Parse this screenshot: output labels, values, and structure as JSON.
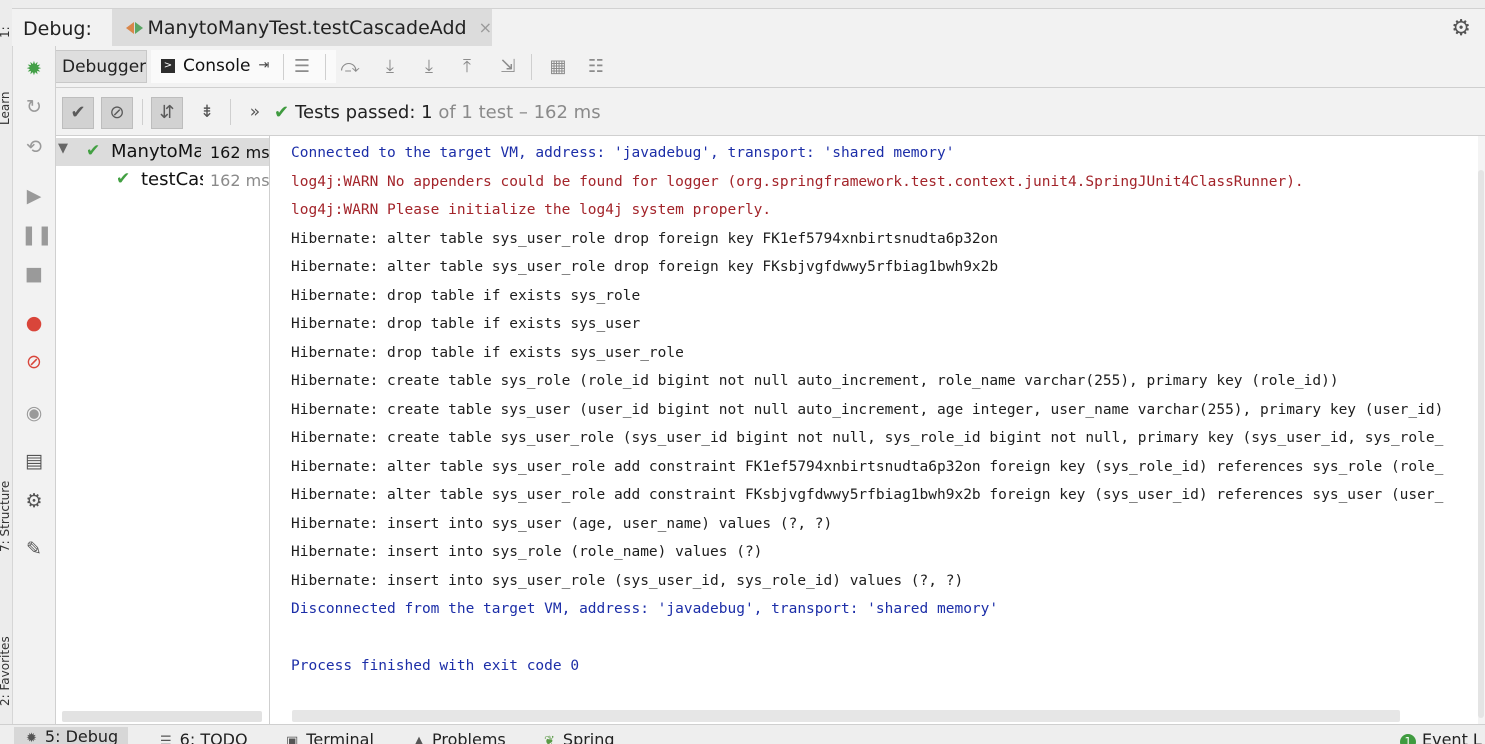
{
  "left_strip": {
    "labels": [
      "1:",
      "Learn",
      "7: Structure",
      "2: Favorites"
    ]
  },
  "debug_bar": {
    "label": "Debug:",
    "session_title": "ManytoManyTest.testCascadeAdd",
    "close_glyph": "×"
  },
  "tabs": {
    "debugger": "Debugger",
    "console": "Console"
  },
  "test_toolbar": {
    "status_prefix": "Tests passed:",
    "passed_count": "1",
    "status_suffix": "of 1 test – 162 ms"
  },
  "test_tree": [
    {
      "name": "ManytoMa",
      "time": "162 ms",
      "selected": true,
      "expanded": true
    },
    {
      "name": "testCas",
      "time": "162 ms",
      "selected": false
    }
  ],
  "console_lines": [
    {
      "text": "Connected to the target VM, address: 'javadebug', transport: 'shared memory'",
      "kind": "system"
    },
    {
      "text": "log4j:WARN No appenders could be found for logger (org.springframework.test.context.junit4.SpringJUnit4ClassRunner).",
      "kind": "error"
    },
    {
      "text": "log4j:WARN Please initialize the log4j system properly.",
      "kind": "error"
    },
    {
      "text": "Hibernate: alter table sys_user_role drop foreign key FK1ef5794xnbirtsnudta6p32on",
      "kind": "output"
    },
    {
      "text": "Hibernate: alter table sys_user_role drop foreign key FKsbjvgfdwwy5rfbiag1bwh9x2b",
      "kind": "output"
    },
    {
      "text": "Hibernate: drop table if exists sys_role",
      "kind": "output"
    },
    {
      "text": "Hibernate: drop table if exists sys_user",
      "kind": "output"
    },
    {
      "text": "Hibernate: drop table if exists sys_user_role",
      "kind": "output"
    },
    {
      "text": "Hibernate: create table sys_role (role_id bigint not null auto_increment, role_name varchar(255), primary key (role_id))",
      "kind": "output"
    },
    {
      "text": "Hibernate: create table sys_user (user_id bigint not null auto_increment, age integer, user_name varchar(255), primary key (user_id)",
      "kind": "output"
    },
    {
      "text": "Hibernate: create table sys_user_role (sys_user_id bigint not null, sys_role_id bigint not null, primary key (sys_user_id, sys_role_",
      "kind": "output"
    },
    {
      "text": "Hibernate: alter table sys_user_role add constraint FK1ef5794xnbirtsnudta6p32on foreign key (sys_role_id) references sys_role (role_",
      "kind": "output"
    },
    {
      "text": "Hibernate: alter table sys_user_role add constraint FKsbjvgfdwwy5rfbiag1bwh9x2b foreign key (sys_user_id) references sys_user (user_",
      "kind": "output"
    },
    {
      "text": "Hibernate: insert into sys_user (age, user_name) values (?, ?)",
      "kind": "output"
    },
    {
      "text": "Hibernate: insert into sys_role (role_name) values (?)",
      "kind": "output"
    },
    {
      "text": "Hibernate: insert into sys_user_role (sys_user_id, sys_role_id) values (?, ?)",
      "kind": "output"
    },
    {
      "text": "Disconnected from the target VM, address: 'javadebug', transport: 'shared memory'",
      "kind": "system"
    },
    {
      "text": "",
      "kind": "output"
    },
    {
      "text": "Process finished with exit code 0",
      "kind": "system"
    }
  ],
  "bottom_tabs": [
    {
      "label": "5: Debug",
      "icon": "bug-icon",
      "active": true
    },
    {
      "label": "6: TODO",
      "icon": "list-icon",
      "active": false
    },
    {
      "label": "Terminal",
      "icon": "terminal-icon",
      "active": false
    },
    {
      "label": "Problems",
      "icon": "warning-icon",
      "active": false
    },
    {
      "label": "Spring",
      "icon": "spring-leaf-icon",
      "active": false
    },
    {
      "label": "Event L",
      "icon": "event-log-icon",
      "active": false,
      "badge": "1"
    }
  ],
  "colors": {
    "system_text": "#1c2ea8",
    "error_text": "#a3242a",
    "output_text": "#1e1e1e",
    "pass_green": "#3f9b3f",
    "accent_debug_green": "#43a047"
  }
}
